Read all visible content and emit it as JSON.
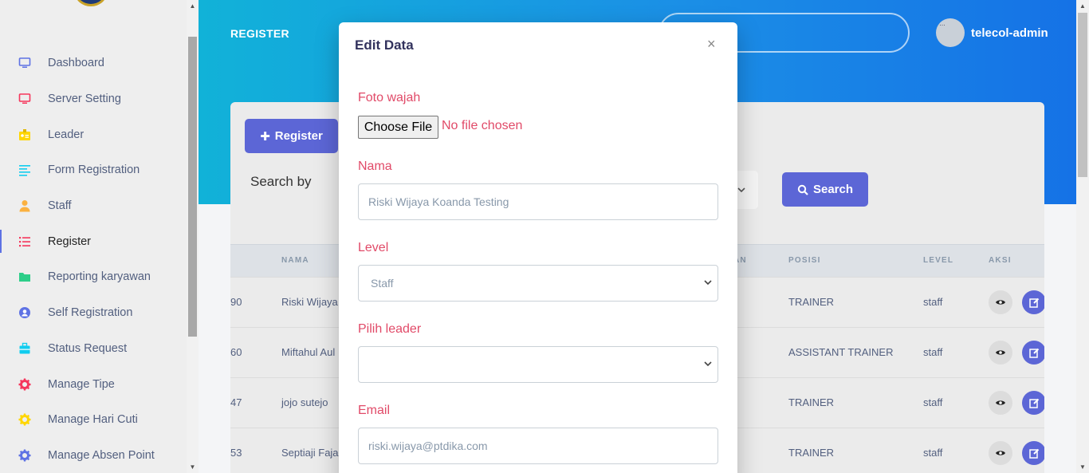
{
  "sidebar": {
    "items": [
      {
        "label": "Dashboard",
        "icon": "monitor-icon",
        "color": "#5e72e4"
      },
      {
        "label": "Server Setting",
        "icon": "monitor-icon",
        "color": "#f5365c"
      },
      {
        "label": "Leader",
        "icon": "badge-icon",
        "color": "#ffd600"
      },
      {
        "label": "Form Registration",
        "icon": "align-left-icon",
        "color": "#11cdef"
      },
      {
        "label": "Staff",
        "icon": "user-icon",
        "color": "#fbb140"
      },
      {
        "label": "Register",
        "icon": "list-icon",
        "color": "#f5365c"
      },
      {
        "label": "Reporting karyawan",
        "icon": "folder-icon",
        "color": "#2dce89"
      },
      {
        "label": "Self Registration",
        "icon": "user-circle-icon",
        "color": "#5e72e4"
      },
      {
        "label": "Status Request",
        "icon": "briefcase-icon",
        "color": "#11cdef"
      },
      {
        "label": "Manage Tipe",
        "icon": "gear-icon",
        "color": "#f5365c"
      },
      {
        "label": "Manage Hari Cuti",
        "icon": "gear-icon",
        "color": "#ffd600"
      },
      {
        "label": "Manage Absen Point",
        "icon": "gear-icon",
        "color": "#5e72e4"
      }
    ],
    "active_index": 5
  },
  "header": {
    "page_title": "REGISTER",
    "user_name": "telecol-admin",
    "avatar_alt": "..."
  },
  "toolbar": {
    "register_label": "Register",
    "search_by_label": "Search by",
    "search_label": "Search"
  },
  "table": {
    "columns": [
      "NAMA",
      "AN",
      "POSISI",
      "LEVEL",
      "AKSI"
    ],
    "rows": [
      {
        "id": "90",
        "nama": "Riski Wijaya",
        "posisi": "TRAINER",
        "level": "staff"
      },
      {
        "id": "60",
        "nama": "Miftahul Aul",
        "posisi": "ASSISTANT TRAINER",
        "level": "staff"
      },
      {
        "id": "47",
        "nama": "jojo sutejo",
        "posisi": "TRAINER",
        "level": "staff"
      },
      {
        "id": "53",
        "nama": "Septiaji Faja",
        "posisi": "TRAINER",
        "level": "staff"
      }
    ]
  },
  "modal": {
    "title": "Edit Data",
    "close": "×",
    "foto_label": "Foto wajah",
    "file_button": "Choose File",
    "file_status": "No file chosen",
    "nama_label": "Nama",
    "nama_value": "Riski Wijaya Koanda Testing",
    "level_label": "Level",
    "level_value": "Staff",
    "leader_label": "Pilih leader",
    "leader_value": "",
    "email_label": "Email",
    "email_value": "riski.wijaya@ptdika.com"
  },
  "colors": {
    "accent": "#5c66d6",
    "label_red": "#e14a68",
    "header_gradient_start": "#11b2d8",
    "header_gradient_end": "#1572e6"
  }
}
